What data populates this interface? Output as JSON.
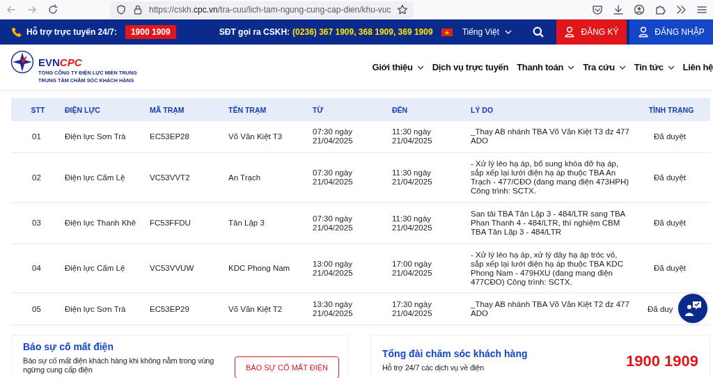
{
  "browser": {
    "url_host": "https://cskh.",
    "url_domain": "cpc.vn",
    "url_path": "/tra-cuu/lich-tam-ngung-cung-cap-dien/khu-vuc"
  },
  "topbar": {
    "hotline_label": "Hỗ trợ trực tuyến 24/7:",
    "hotline_number": "1900 1909",
    "cskh_label": "SĐT gọi ra CSKH:",
    "cskh_numbers": "(0236) 367 1909, 368 1909, 369 1909",
    "language": "Tiếng Việt",
    "register": "ĐĂNG KÝ",
    "login": "ĐĂNG NHẬP"
  },
  "header": {
    "logo": {
      "brand_a": "EVN",
      "brand_b": "CPC",
      "line_1": "TỔNG CÔNG TY ĐIỆN LỰC MIỀN TRUNG",
      "line_2": "TRUNG TÂM CHĂM SÓC KHÁCH HÀNG"
    },
    "menu": [
      {
        "label": "Giới thiệu",
        "dropdown": true
      },
      {
        "label": "Dịch vụ trực tuyến",
        "dropdown": false
      },
      {
        "label": "Thanh toán",
        "dropdown": true
      },
      {
        "label": "Tra cứu",
        "dropdown": true
      },
      {
        "label": "Tin tức",
        "dropdown": true
      },
      {
        "label": "Liên hệ",
        "dropdown": false
      }
    ]
  },
  "table": {
    "columns": [
      "STT",
      "ĐIỆN LỰC",
      "MÃ TRẠM",
      "TÊN TRẠM",
      "TỪ",
      "ĐẾN",
      "LÝ DO",
      "TÌNH TRẠNG"
    ],
    "rows": [
      {
        "cells": [
          "01",
          "Điện lực Sơn Trà",
          "EC53EP28",
          "Võ Văn Kiệt T3",
          "07:30 ngày 21/04/2025",
          "11:30 ngày 21/04/2025",
          "_Thay AB nhánh TBA Võ Văn Kiệt T3 đz 477 ADO",
          "Đã duyệt"
        ]
      },
      {
        "cells": [
          "02",
          "Điện lực Cẩm Lệ",
          "VC53VVT2",
          "An Trạch",
          "07:30 ngày 21/04/2025",
          "11:30 ngày 21/04/2025",
          "- Xử lý lèo hạ áp, bổ sung khóa đỡ hạ áp, sắp xếp lại lưới điện hạ áp thuộc TBA An Trạch - 477/CĐO (đang mang điện 473HPH) Công trình: SCTX.",
          "Đã duyệt"
        ]
      },
      {
        "cells": [
          "03",
          "Điện lực Thanh Khê",
          "FC53FFDU",
          "Tân Lập 3",
          "07:30 ngày 21/04/2025",
          "11:30 ngày 21/04/2025",
          "San tải TBA Tân Lập 3 - 484/LTR sang TBA Phan Thanh 4 - 484/LTR, thí nghiệm CBM TBA Tân Lập 3 - 484/LTR",
          "Đã duyệt"
        ]
      },
      {
        "cells": [
          "04",
          "Điện lực Cẩm Lệ",
          "VC53VVUW",
          "KDC Phong Nam",
          "13:00 ngày 21/04/2025",
          "17:00 ngày 21/04/2025",
          "- Xử lý lèo hạ áp, xử lý dây hạ áp tróc vỏ, sắp xếp lại lưới điện hạ áp thuộc TBA KDC Phong Nam - 479HXU (đang mang điện 477CĐO) Công trình: SCTX.",
          "Đã duyệt"
        ]
      },
      {
        "cells": [
          "05",
          "Điện lực Sơn Trà",
          "EC53EP29",
          "Võ Văn Kiệt T2",
          "13:30 ngày 21/04/2025",
          "17:30 ngày 21/04/2025",
          "_Thay AB nhánh TBA Võ Văn Kiệt T2 đz 477 ADO",
          "Đã duy"
        ]
      }
    ]
  },
  "report_card": {
    "title": "Báo sự cố mất điện",
    "text": "Báo sự cố mất điện khách hàng khi không nằm trong vùng ngừng cung cấp điện",
    "button": "BÁO SỰ CỐ MẤT ĐIỆN"
  },
  "hotline_card": {
    "title": "Tổng đài chăm sóc khách hàng",
    "text": "Hỗ trợ 24/7 các dịch vụ về điện",
    "number": "1900 1909"
  }
}
